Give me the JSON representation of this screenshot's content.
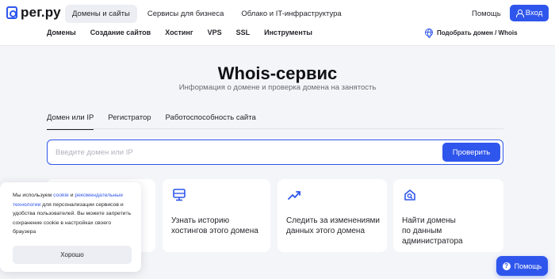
{
  "header": {
    "logo": "рег.ру",
    "tabs": [
      {
        "label": "Домены и сайты"
      },
      {
        "label": "Сервисы для бизнеса"
      },
      {
        "label": "Облако и IT-инфраструктура"
      }
    ],
    "help_label": "Помощь",
    "login_label": "Вход",
    "nav": [
      {
        "label": "Домены"
      },
      {
        "label": "Создание сайтов"
      },
      {
        "label": "Хостинг"
      },
      {
        "label": "VPS"
      },
      {
        "label": "SSL"
      },
      {
        "label": "Инструменты"
      }
    ],
    "domain_picker_label": "Подобрать домен / Whois"
  },
  "hero": {
    "title": "Whois-сервис",
    "subtitle": "Информация о домене и проверка домена на занятость"
  },
  "search_tabs": [
    {
      "label": "Домен или IP"
    },
    {
      "label": "Регистратор"
    },
    {
      "label": "Работоспособность сайта"
    }
  ],
  "search": {
    "placeholder": "Введите домен или IP",
    "value": "",
    "button_label": "Проверить"
  },
  "cards": [
    {
      "icon": "card-icon",
      "line1": "",
      "line2": ""
    },
    {
      "icon": "server-history-icon",
      "line1": "Узнать историю",
      "line2": "хостингов этого домена"
    },
    {
      "icon": "chart-trend-icon",
      "line1": "Следить за изменениями",
      "line2": "данных этого домена"
    },
    {
      "icon": "house-search-icon",
      "line1": "Найти домены",
      "line2": "по данным",
      "line3": "администратора"
    }
  ],
  "cookie_banner": {
    "text_1": "Мы используем ",
    "link_1": "cookie",
    "text_2": " и ",
    "link_2": "рекомендательные технологии",
    "text_3": " для персонализации сервисов и удобства пользователей. Вы можете запретить сохранение cookie в настройках своего браузера",
    "ok_label": "Хорошо"
  },
  "help_widget": {
    "label": "Помощь",
    "icon_glyph": "?"
  },
  "colors": {
    "accent": "#2f56ec",
    "background": "#f4f5f8"
  }
}
